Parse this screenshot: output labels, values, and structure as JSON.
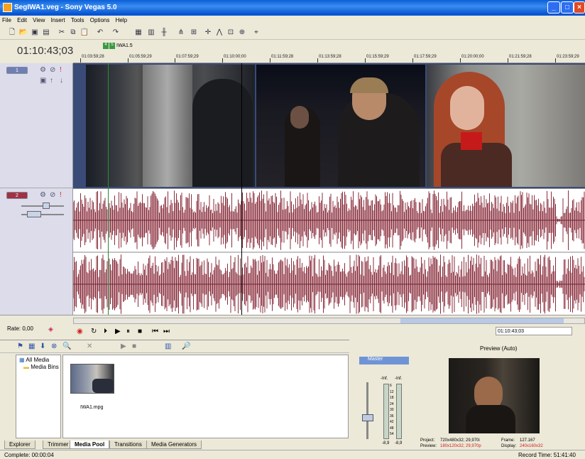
{
  "window": {
    "title": "SegIWA1.veg - Sony Vegas 5.0"
  },
  "menu": [
    "File",
    "Edit",
    "View",
    "Insert",
    "Tools",
    "Options",
    "Help"
  ],
  "timeline": {
    "timecode": "01:10:43;03",
    "marker_label": "IWA1.5",
    "marker_badges": [
      "4",
      "5"
    ],
    "ruler_labels": [
      "01:03:59;28",
      "01:05:59;29",
      "01:07:59;29",
      "01:10:00;00",
      "01:11:59;28",
      "01:13:59;28",
      "01:15:59;29",
      "01:17:59;29",
      "01:20:00;00",
      "01:21:59;28",
      "01:23:59;29"
    ],
    "video_track_number": "1",
    "audio_track_number": "2"
  },
  "transport": {
    "rate": "Rate: 0,00",
    "timecode": "01:10:43;03"
  },
  "media_pool": {
    "tree": [
      "All Media",
      "Media Bins"
    ],
    "files": [
      {
        "name": "IWA1.mpg"
      }
    ]
  },
  "tabs": [
    "Explorer",
    "Trimmer",
    "Media Pool",
    "Transitions",
    "Media Generators"
  ],
  "active_tab": "Media Pool",
  "mixer": {
    "label": "Master",
    "inf_left": "-Inf.",
    "inf_right": "-Inf.",
    "scale": [
      "6",
      "12",
      "18",
      "24",
      "30",
      "36",
      "42",
      "48",
      "54"
    ],
    "readout_left": "-8,9",
    "readout_right": "-8,9"
  },
  "preview": {
    "mode": "Preview (Auto)",
    "project_label": "Project:",
    "project": "720x480x32; 29,970i",
    "preview_label": "Preview:",
    "preview": "180x120x32; 29,970p",
    "frame_label": "Frame:",
    "frame": "127.167",
    "display_label": "Display:",
    "display": "240x160x32"
  },
  "status": {
    "left": "Complete: 00:00:04",
    "right": "Record Time: 51:41:40"
  },
  "colors": {
    "audio_wave": "#8a2e3c",
    "title_bar": "#0a5fd8",
    "video_bg": "#3a4b78"
  }
}
